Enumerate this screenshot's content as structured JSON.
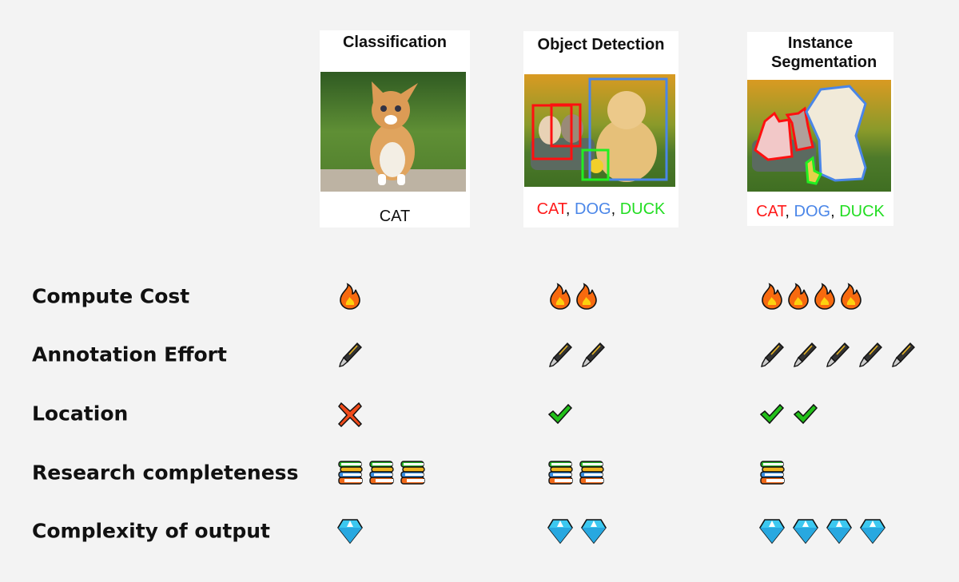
{
  "cards": [
    {
      "title": "Classification",
      "labels": [
        {
          "text": "CAT",
          "color": "#111111"
        }
      ]
    },
    {
      "title": "Object Detection",
      "labels": [
        {
          "text": "CAT",
          "color": "#ff1a1a"
        },
        {
          "text": ", ",
          "color": "#111111"
        },
        {
          "text": "DOG",
          "color": "#4a86e8"
        },
        {
          "text": ", ",
          "color": "#111111"
        },
        {
          "text": "DUCK",
          "color": "#22dd22"
        }
      ]
    },
    {
      "title": "Instance Segmentation",
      "labels": [
        {
          "text": "CAT",
          "color": "#ff1a1a"
        },
        {
          "text": ", ",
          "color": "#111111"
        },
        {
          "text": "DOG",
          "color": "#4a86e8"
        },
        {
          "text": ", ",
          "color": "#111111"
        },
        {
          "text": "DUCK",
          "color": "#22dd22"
        }
      ]
    }
  ],
  "rows": [
    {
      "label": "Compute Cost",
      "icon": "fire-icon",
      "counts": [
        1,
        2,
        4
      ]
    },
    {
      "label": "Annotation Effort",
      "icon": "pen-icon",
      "counts": [
        1,
        2,
        5
      ]
    },
    {
      "label": "Location",
      "icon": [
        "cross-icon",
        "check-icon",
        "check-icon"
      ],
      "counts": [
        1,
        1,
        2
      ]
    },
    {
      "label": "Research completeness",
      "icon": "books-icon",
      "counts": [
        3,
        2,
        1
      ]
    },
    {
      "label": "Complexity of output",
      "icon": "gem-icon",
      "counts": [
        1,
        2,
        4
      ]
    }
  ]
}
